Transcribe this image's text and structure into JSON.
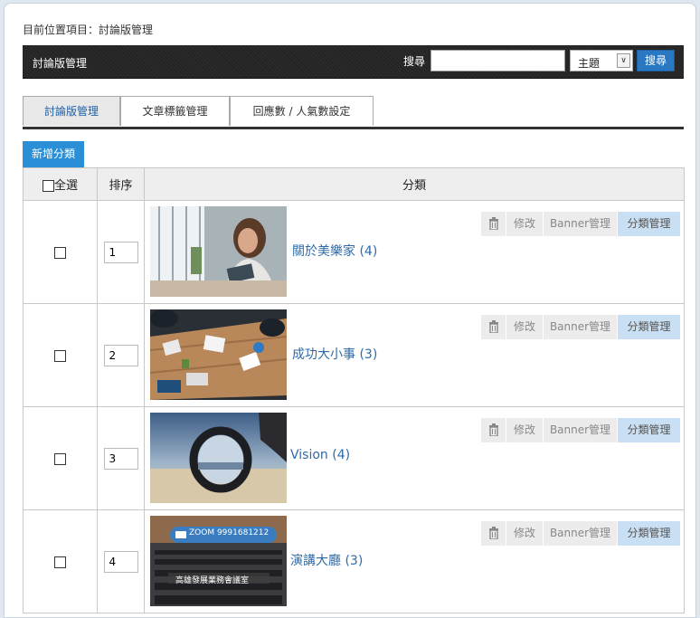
{
  "breadcrumb": "目前位置項目：討論版管理",
  "topbar": {
    "title": "討論版管理",
    "search_label": "搜尋",
    "search_value": "",
    "search_select": "主題",
    "search_button": "搜尋"
  },
  "tabs": [
    {
      "label": "討論版管理",
      "active": true
    },
    {
      "label": "文章標籤管理",
      "active": false
    },
    {
      "label": "回應數 / 人氣數設定",
      "active": false
    }
  ],
  "add_button": "新增分類",
  "table": {
    "headers": {
      "select_all": "全選",
      "order": "排序",
      "category": "分類"
    }
  },
  "actions": {
    "edit": "修改",
    "banner": "Banner管理",
    "category": "分類管理"
  },
  "rows": [
    {
      "order": "1",
      "name": "關於美樂家 (4)",
      "image": "woman-with-tablet-photo"
    },
    {
      "order": "2",
      "name": "成功大小事 (3)",
      "image": "meeting-table-photo"
    },
    {
      "order": "3",
      "name": "Vision (4)",
      "image": "lens-sunset-photo"
    },
    {
      "order": "4",
      "name": "演講大廳 (3)",
      "image": "lecture-hall-photo",
      "overlay_zoom": "ZOOM 9991681212",
      "overlay_caption": "高雄發展業務會議室"
    }
  ],
  "colors": {
    "accent": "#2a78c2",
    "link": "#2e6aa8",
    "category_button": "#c9dff3"
  }
}
